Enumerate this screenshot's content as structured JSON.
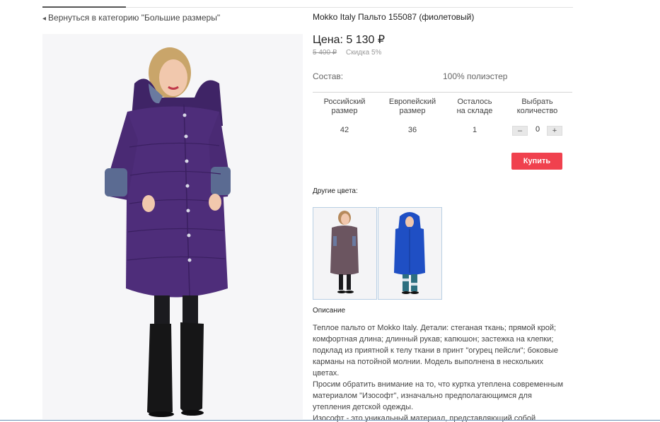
{
  "back_link": {
    "label": "Вернуться в категорию \"Большие размеры\""
  },
  "product": {
    "title": "Mokko Italy Пальто 155087 (фиолетовый)",
    "price": "Цена: 5 130 ₽",
    "old_price": "5 400 ₽",
    "discount": "Скидка 5%",
    "composition_label": "Состав:",
    "composition_value": "100% полиэстер"
  },
  "size_table": {
    "headers": [
      "Российский размер",
      "Европейский размер",
      "Осталось на складе",
      "Выбрать количество"
    ],
    "header_lines": [
      [
        "Российский",
        "размер"
      ],
      [
        "Европейский",
        "размер"
      ],
      [
        "Осталось",
        "на складе"
      ],
      [
        "Выбрать",
        "количество"
      ]
    ],
    "row": {
      "ru_size": "42",
      "eu_size": "36",
      "stock": "1",
      "quantity": "0"
    },
    "minus": "–",
    "plus": "+"
  },
  "buy_button": {
    "label": "Купить"
  },
  "other_colors": {
    "label": "Другие цвета:"
  },
  "description": {
    "title": "Описание",
    "text": "Теплое пальто от Mokko Italy. Детали: стеганая ткань; прямой крой; комфортная длина; длинный рукав; капюшон; застежка на клепки; подклад из приятной к телу ткани в принт \"огурец пейсли\"; боковые карманы на потойной молнии. Модель выполнена в нескольких цветах.",
    "text2": "Просим обратить внимание на то, что куртка утеплена современным материалом \"Изософт\", изначально предполагающимся для утепления детской одежды.",
    "text3": "Изософт - это уникальный материал, представляющий собой"
  },
  "colors": {
    "coat_purple": "#4e2d7a",
    "coat_brown": "#6b5560",
    "coat_blue": "#1f4fc4",
    "buy_red": "#f0414e",
    "thumb_border": "#b9cfe4"
  }
}
